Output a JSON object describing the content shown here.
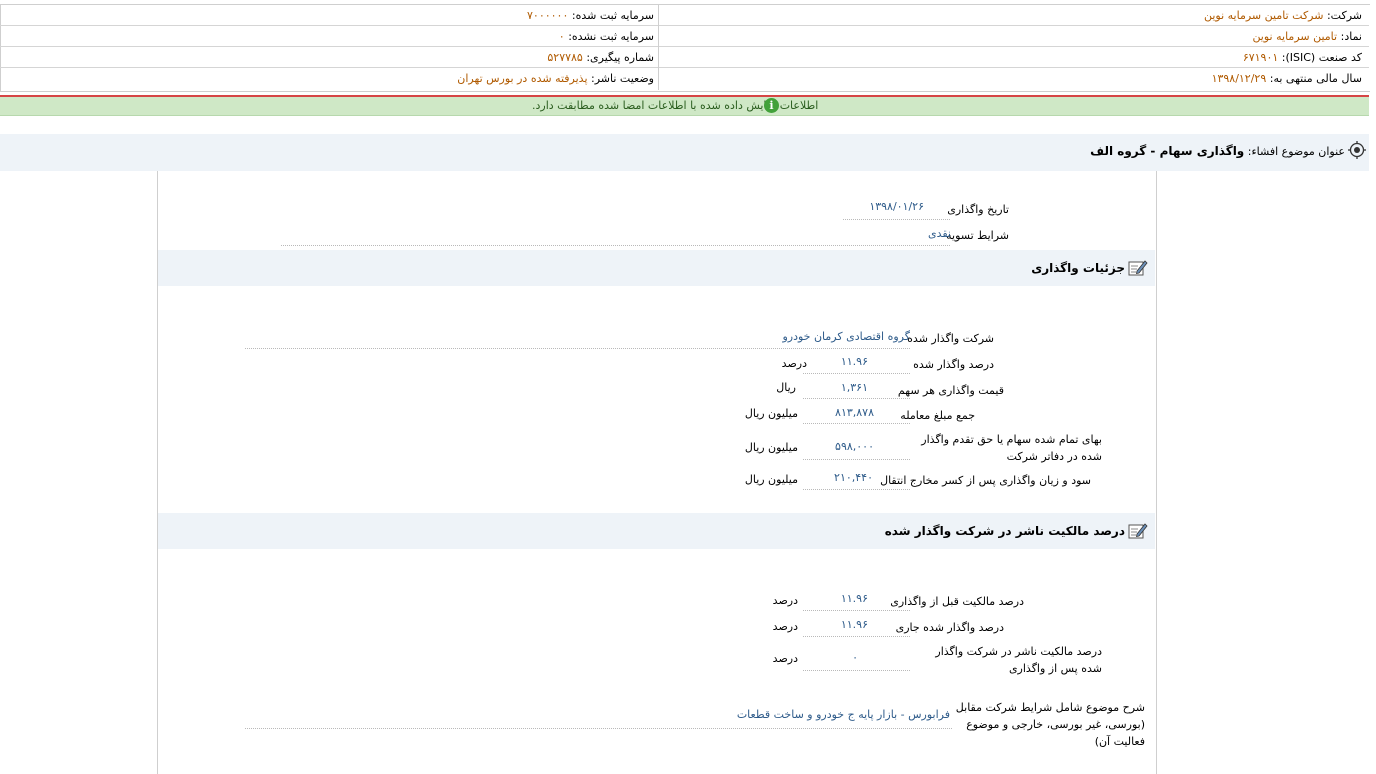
{
  "header": {
    "company_label": "شرکت:",
    "company_value": "شرکت تامین سرمایه نوین",
    "registered_capital_label": "سرمایه ثبت شده:",
    "registered_capital_value": "۷۰۰۰۰۰۰",
    "symbol_label": "نماد:",
    "symbol_value": "تامین سرمایه نوین",
    "unregistered_capital_label": "سرمایه ثبت نشده:",
    "unregistered_capital_value": "۰",
    "isic_label": "کد صنعت (ISIC):",
    "isic_value": "۶۷۱۹۰۱",
    "tracking_label": "شماره پیگیری:",
    "tracking_value": "۵۲۷۷۸۵",
    "fiscal_year_label": "سال مالی منتهی به:",
    "fiscal_year_value": "۱۳۹۸/۱۲/۲۹",
    "publisher_status_label": "وضعیت ناشر:",
    "publisher_status_value": "پذیرفته شده در بورس تهران"
  },
  "notice": {
    "text": "اطلاعات نمایش داده شده با اطلاعات امضا شده مطابقت دارد.",
    "icon": "info-icon"
  },
  "disclosure": {
    "subject_label": "عنوان موضوع افشاء:",
    "subject_value": "واگذاری سهام - گروه الف"
  },
  "transfer": {
    "date_label": "تاریخ واگذاری",
    "date_value": "۱۳۹۸/۰۱/۲۶",
    "settlement_label": "شرایط تسویه",
    "settlement_value": "نقدی"
  },
  "details": {
    "title": "جزئیات واگذاری",
    "rows": [
      {
        "label": "شرکت واگذار شده",
        "value": "گروه اقتصادی کرمان خودرو",
        "unit": ""
      },
      {
        "label": "درصد واگذار شده",
        "value": "۱۱.۹۶",
        "unit": "درصد"
      },
      {
        "label": "قیمت واگذاری هر سهم",
        "value": "۱,۳۶۱",
        "unit": "ریال"
      },
      {
        "label": "جمع مبلغ معامله",
        "value": "۸۱۳,۸۷۸",
        "unit": "میلیون ریال"
      },
      {
        "label": "بهای تمام شده سهام یا حق تقدم واگذار شده در دفاتر شرکت",
        "value": "۵۹۸,۰۰۰",
        "unit": "میلیون ریال"
      },
      {
        "label": "سود و زیان واگذاری پس از کسر مخارج انتقال",
        "value": "۲۱۰,۴۴۰",
        "unit": "میلیون ریال"
      }
    ]
  },
  "ownership": {
    "title": "درصد مالکیت ناشر در شرکت واگذار شده",
    "rows": [
      {
        "label": "درصد مالکیت قبل از واگذاری",
        "value": "۱۱.۹۶",
        "unit": "درصد"
      },
      {
        "label": "درصد واگذار شده جاری",
        "value": "۱۱.۹۶",
        "unit": "درصد"
      },
      {
        "label": "درصد مالکیت ناشر در شرکت واگذار شده پس از واگذاری",
        "value": "۰",
        "unit": "درصد"
      }
    ],
    "description_label": "شرح موضوع شامل شرایط شرکت مقابل (بورسی، غیر بورسی، خارجی و موضوع فعالیت آن)",
    "description_value": "فرابورس - بازار پایه ج خودرو و ساخت قطعات"
  },
  "colors": {
    "accent_green": "#cfe8c6",
    "section_bg": "#eef3f8",
    "link_blue": "#2e5b8a",
    "orange": "#b05a00"
  }
}
